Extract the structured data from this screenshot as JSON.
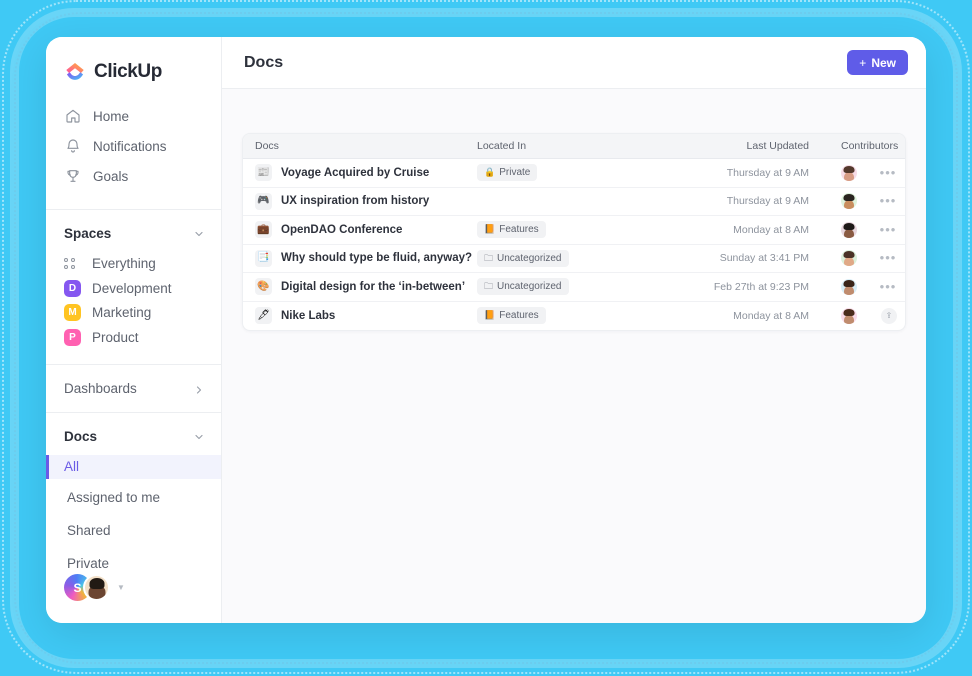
{
  "theme": {
    "background": "#3FC9F5",
    "accent": "#5F5CE8",
    "active_nav": "#6B5BE6"
  },
  "sidebar": {
    "brand": "ClickUp",
    "nav": [
      {
        "label": "Home",
        "icon": "home-icon"
      },
      {
        "label": "Notifications",
        "icon": "bell-icon"
      },
      {
        "label": "Goals",
        "icon": "trophy-icon"
      }
    ],
    "spaces_section": {
      "title": "Spaces",
      "chevron": "chevron-down-icon",
      "everything": {
        "label": "Everything",
        "icon": "grid-icon"
      },
      "spaces": [
        {
          "label": "Development",
          "initial": "D",
          "color": "#8557F0"
        },
        {
          "label": "Marketing",
          "initial": "M",
          "color": "#FFC422"
        },
        {
          "label": "Product",
          "initial": "P",
          "color": "#FF61B1"
        }
      ]
    },
    "dashboards": {
      "title": "Dashboards",
      "chevron": "chevron-right-icon"
    },
    "docs_section": {
      "title": "Docs",
      "chevron": "chevron-down-icon",
      "filters": [
        {
          "label": "All",
          "active": true
        },
        {
          "label": "Assigned to me",
          "active": false
        },
        {
          "label": "Shared",
          "active": false
        },
        {
          "label": "Private",
          "active": false
        }
      ]
    },
    "footer": {
      "workspace_initial": "S",
      "caret": "chevron-down-icon"
    }
  },
  "topbar": {
    "title": "Docs",
    "new_button": {
      "plus": "+",
      "label": "New"
    }
  },
  "table": {
    "columns": [
      "Docs",
      "Located In",
      "Last Updated",
      "Contributors"
    ],
    "rows": [
      {
        "icon": "newspaper-emoji",
        "glyph": "📰",
        "title": "Voyage Acquired by Cruise",
        "located_in": "Private",
        "located_icon": "lock-icon",
        "located_glyph": "🔒",
        "updated": "Thursday at 9 AM",
        "avatar_bg": "#F7DCE6",
        "avatar_face": "#D79C84",
        "avatar_hair": "#53392C",
        "extra_avatar": false,
        "menu": "•••"
      },
      {
        "icon": "videogame-emoji",
        "glyph": "🎮",
        "title": "UX inspiration from history",
        "located_in": "",
        "located_icon": "",
        "located_glyph": "",
        "updated": "Thursday at 9 AM",
        "avatar_bg": "#DFF2DC",
        "avatar_face": "#C98D5E",
        "avatar_hair": "#2A2420",
        "extra_avatar": false,
        "menu": "•••"
      },
      {
        "icon": "briefcase-emoji",
        "glyph": "💼",
        "title": "OpenDAO Conference",
        "located_in": "Features",
        "located_icon": "folder-filled-icon",
        "located_glyph": "📙",
        "updated": "Monday at 8 AM",
        "avatar_bg": "#E8D7DD",
        "avatar_face": "#8A5B42",
        "avatar_hair": "#1E1A18",
        "extra_avatar": false,
        "menu": "•••"
      },
      {
        "icon": "page-layout-emoji",
        "glyph": "📑",
        "title": "Why should type be fluid, anyway?",
        "located_in": "Uncategorized",
        "located_icon": "folder-outline-icon",
        "located_glyph": "🗀",
        "updated": "Sunday at 3:41 PM",
        "avatar_bg": "#DCF0DB",
        "avatar_face": "#E0A987",
        "avatar_hair": "#4A3226",
        "extra_avatar": false,
        "menu": "•••"
      },
      {
        "icon": "artist-palette-emoji",
        "glyph": "🎨",
        "title": "Digital design for the ‘in-between’",
        "located_in": "Uncategorized",
        "located_icon": "folder-outline-icon",
        "located_glyph": "🗀",
        "updated": "Feb 27th at 9:23 PM",
        "avatar_bg": "#D9EDF6",
        "avatar_face": "#C08C6E",
        "avatar_hair": "#3A2418",
        "extra_avatar": false,
        "menu": "•••"
      },
      {
        "icon": "pen-emoji",
        "glyph": "🖋",
        "title": "Nike Labs",
        "located_in": "Features",
        "located_icon": "folder-filled-icon",
        "located_glyph": "📙",
        "updated": "Monday at 8 AM",
        "avatar_bg": "#F9DCEA",
        "avatar_face": "#C08C6E",
        "avatar_hair": "#4A2C1C",
        "extra_avatar": true,
        "extra_avatar_glyph": "⇪",
        "menu": "•••"
      }
    ]
  }
}
